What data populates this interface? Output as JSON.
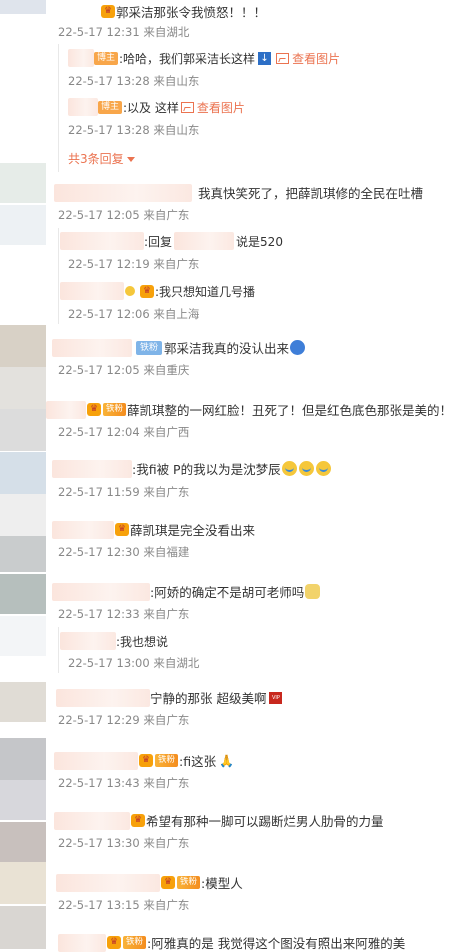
{
  "thread": {
    "root_text": "郭采洁那张令我愤怒！！！",
    "root_meta": "22-5-17 12:31 来自湖北",
    "replies": [
      {
        "badge": "博主",
        "text": ":哈哈，我们郭采洁长这样",
        "link": "查看图片",
        "meta": "22-5-17 13:28 来自山东"
      },
      {
        "badge": "博主",
        "text": ":以及 这样",
        "link": "查看图片",
        "meta": "22-5-17 13:28 来自山东"
      }
    ],
    "more_replies": "共3条回复"
  },
  "comments": [
    {
      "text": "我真快笑死了，把薛凯琪修的全民在吐槽",
      "meta": "22-5-17 12:05 来自广东"
    },
    {
      "text": ":回复",
      "text2": "说是520",
      "meta": "22-5-17 12:19 来自广东"
    },
    {
      "text": ":我只想知道几号播",
      "meta": "22-5-17 12:06 来自上海"
    },
    {
      "badge": "铁粉",
      "text": "郭采洁我真的没认出来",
      "meta": "22-5-17 12:05 来自重庆"
    },
    {
      "badge": "铁粉",
      "text": "薛凯琪整的一网红脸！丑死了！但是红色底色那张是美的！",
      "meta": "22-5-17 12:04 来自广西"
    },
    {
      "text": ":我fi被 P的我以为是沈梦辰",
      "meta": "22-5-17 11:59 来自广东"
    },
    {
      "text": "薛凯琪是完全没看出来",
      "meta": "22-5-17 12:30 来自福建"
    },
    {
      "text": ":阿娇的确定不是胡可老师吗",
      "meta": "22-5-17 12:33 来自广东"
    },
    {
      "text": ":我也想说",
      "meta": "22-5-17 13:00 来自湖北"
    },
    {
      "text": "宁静的那张 超级美啊",
      "meta": "22-5-17 12:29 来自广东"
    },
    {
      "badge": "铁粉",
      "text": ":fi这张",
      "meta": "22-5-17 13:43 来自广东"
    },
    {
      "text": "希望有那种一脚可以踢断烂男人肋骨的力量",
      "meta": "22-5-17 13:30 来自广东"
    },
    {
      "badge": "铁粉",
      "text": ":模型人",
      "meta": "22-5-17 13:15 来自广东"
    },
    {
      "badge": "铁粉",
      "text": ":阿雅真的是 我觉得这个图没有照出来阿雅的美",
      "meta": ""
    }
  ],
  "colors": {
    "accent": "#eb7350",
    "meta": "#888888",
    "iron_badge": "#7fb4e8"
  }
}
